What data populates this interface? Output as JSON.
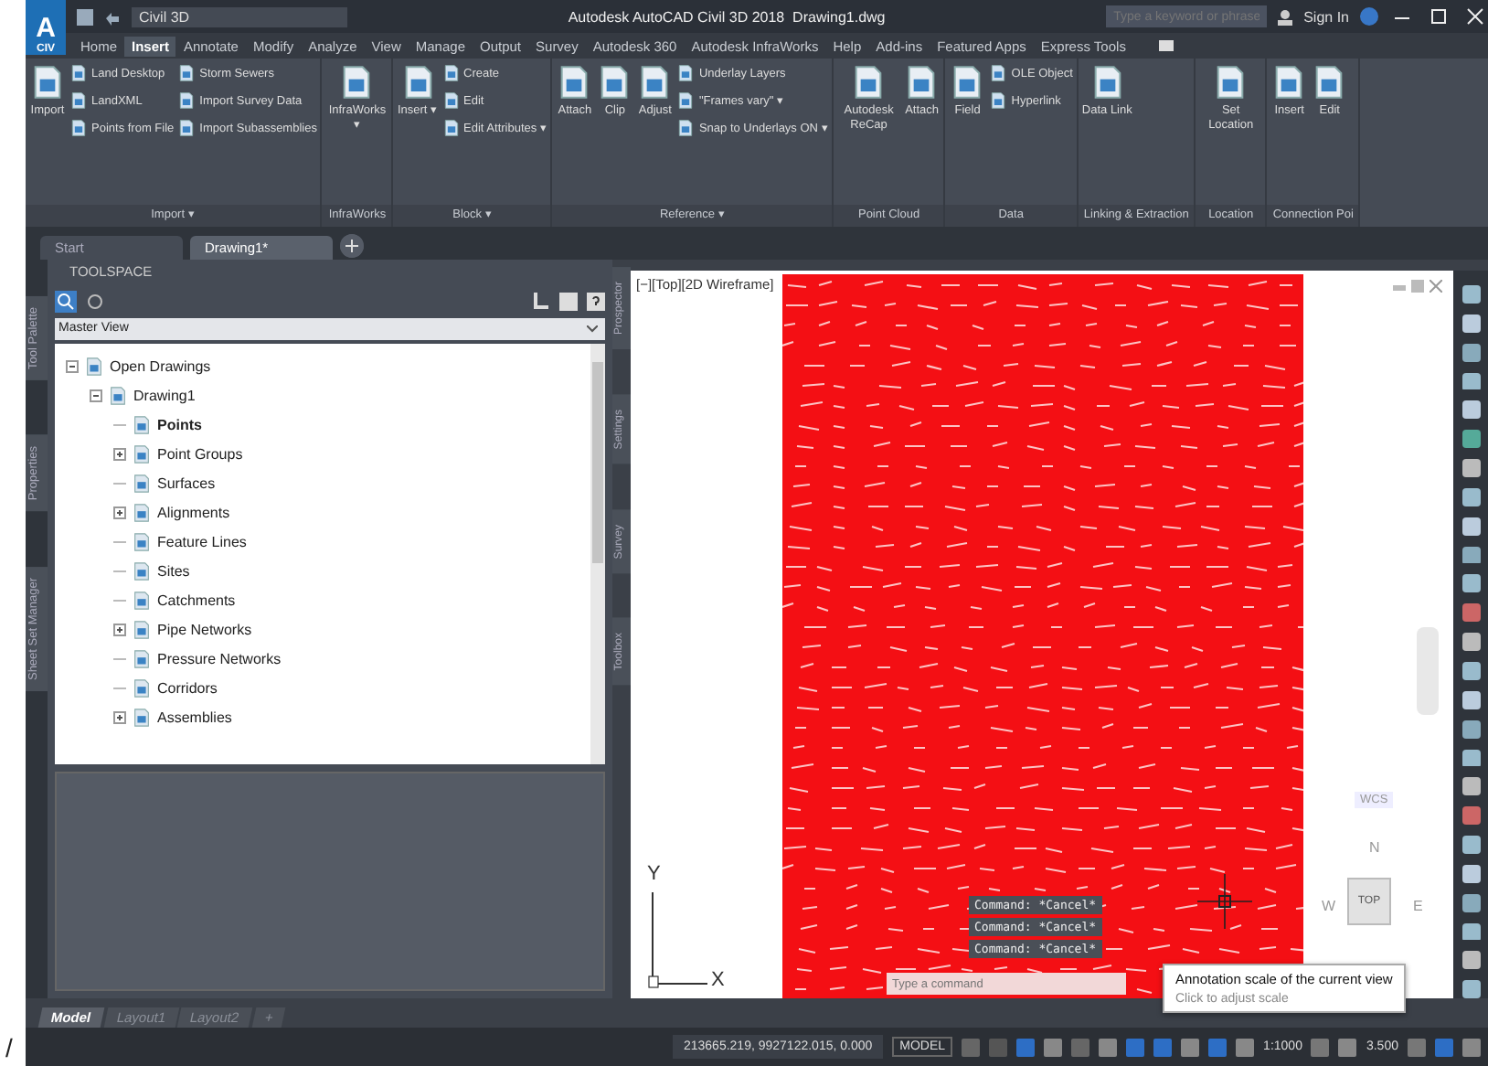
{
  "title_bar": {
    "app_letter": "A",
    "app_button": "CIV",
    "workspace": "Civil 3D",
    "title": "Autodesk AutoCAD Civil 3D 2018",
    "file": "Drawing1.dwg",
    "search": {
      "placeholder": "Type a keyword or phrase"
    },
    "sign_in": "Sign In"
  },
  "ribbon": {
    "tabs": [
      {
        "label": "Home",
        "selected": false
      },
      {
        "label": "Insert",
        "selected": true
      },
      {
        "label": "Annotate",
        "selected": false
      },
      {
        "label": "Modify",
        "selected": false
      },
      {
        "label": "Analyze",
        "selected": false
      },
      {
        "label": "View",
        "selected": false
      },
      {
        "label": "Manage",
        "selected": false
      },
      {
        "label": "Output",
        "selected": false
      },
      {
        "label": "Survey",
        "selected": false
      },
      {
        "label": "Autodesk 360",
        "selected": false
      },
      {
        "label": "Autodesk InfraWorks",
        "selected": false
      },
      {
        "label": "Help",
        "selected": false
      },
      {
        "label": "Add-ins",
        "selected": false
      },
      {
        "label": "Featured Apps",
        "selected": false
      },
      {
        "label": "Express Tools",
        "selected": false
      }
    ],
    "panels": [
      {
        "label": "Import ▾",
        "tools": [
          {
            "label": "Import",
            "kind": "large"
          },
          {
            "label": "Land Desktop",
            "kind": "small"
          },
          {
            "label": "LandXML",
            "kind": "small"
          },
          {
            "label": "Points from File",
            "kind": "small"
          },
          {
            "label": "Storm Sewers",
            "kind": "small"
          },
          {
            "label": "Import Survey Data",
            "kind": "small"
          },
          {
            "label": "Import Subassemblies",
            "kind": "small"
          }
        ]
      },
      {
        "label": "InfraWorks",
        "tools": [
          {
            "label": "InfraWorks ▾",
            "kind": "large"
          }
        ]
      },
      {
        "label": "Block ▾",
        "tools": [
          {
            "label": "Insert ▾",
            "kind": "large"
          },
          {
            "label": "Create",
            "kind": "small"
          },
          {
            "label": "Edit",
            "kind": "small"
          },
          {
            "label": "Edit Attributes ▾",
            "kind": "small"
          }
        ]
      },
      {
        "label": "Reference ▾",
        "tools": [
          {
            "label": "Attach",
            "kind": "large"
          },
          {
            "label": "Clip",
            "kind": "large"
          },
          {
            "label": "Adjust",
            "kind": "large"
          },
          {
            "label": "Underlay Layers",
            "kind": "small"
          },
          {
            "label": "\"Frames vary\" ▾",
            "kind": "small"
          },
          {
            "label": "Snap to Underlays ON ▾",
            "kind": "small"
          }
        ]
      },
      {
        "label": "Point Cloud",
        "tools": [
          {
            "label": "Autodesk ReCap",
            "kind": "large"
          },
          {
            "label": "Attach",
            "kind": "large"
          }
        ]
      },
      {
        "label": "Data",
        "tools": [
          {
            "label": "Field",
            "kind": "large"
          },
          {
            "label": "OLE Object",
            "kind": "small"
          },
          {
            "label": "Hyperlink",
            "kind": "small"
          }
        ]
      },
      {
        "label": "Linking & Extraction",
        "tools": [
          {
            "label": "Data Link",
            "kind": "large"
          }
        ]
      },
      {
        "label": "Location",
        "tools": [
          {
            "label": "Set Location",
            "kind": "large"
          }
        ]
      },
      {
        "label": "Connection Poi",
        "tools": [
          {
            "label": "Insert",
            "kind": "large"
          },
          {
            "label": "Edit",
            "kind": "large"
          }
        ]
      }
    ]
  },
  "file_tabs": [
    {
      "label": "Start",
      "selected": false
    },
    {
      "label": "Drawing1*",
      "selected": true
    }
  ],
  "side_tabs": [
    "Tool Palette",
    "Properties",
    "Sheet Set Manager"
  ],
  "toolspace": {
    "title": "TOOLSPACE",
    "view": "Master View",
    "tabs": [
      "Prospector",
      "Settings",
      "Survey",
      "Toolbox"
    ],
    "tree": [
      {
        "label": "Open Drawings",
        "expanded": true,
        "children": [
          {
            "label": "Drawing1",
            "expanded": true,
            "children": [
              {
                "label": "Points",
                "selected": true
              },
              {
                "label": "Point Groups",
                "expanded": false
              },
              {
                "label": "Surfaces"
              },
              {
                "label": "Alignments",
                "expanded": false
              },
              {
                "label": "Feature Lines"
              },
              {
                "label": "Sites"
              },
              {
                "label": "Catchments"
              },
              {
                "label": "Pipe Networks",
                "expanded": false
              },
              {
                "label": "Pressure Networks"
              },
              {
                "label": "Corridors"
              },
              {
                "label": "Assemblies",
                "expanded": false
              }
            ]
          }
        ]
      }
    ]
  },
  "viewport": {
    "label": "[−][Top][2D Wireframe]",
    "viewcube": {
      "north": "N",
      "west": "W",
      "face": "TOP",
      "east": "E",
      "ucs": "WCS"
    },
    "axis_y": "Y",
    "axis_x": "X",
    "command_history": [
      "Command: *Cancel*",
      "Command: *Cancel*",
      "Command: *Cancel*"
    ],
    "command_line": {
      "placeholder": "Type a command"
    }
  },
  "layout_tabs": [
    {
      "label": "Model",
      "selected": true
    },
    {
      "label": "Layout1",
      "selected": false
    },
    {
      "label": "Layout2",
      "selected": false
    },
    {
      "label": "+",
      "selected": false
    }
  ],
  "status_bar": {
    "coordinates": "213665.219, 9927122.015, 0.000",
    "space": "MODEL",
    "annotation_scale": "1:1000",
    "scale_value": "3.500"
  },
  "tooltip": {
    "title": "Annotation scale of the current view",
    "hint": "Click to adjust scale"
  },
  "margin_mark": "/"
}
